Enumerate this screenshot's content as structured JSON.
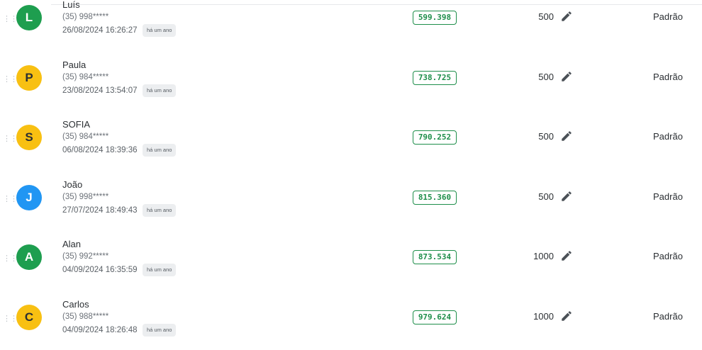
{
  "colors": {
    "green": "#1e9e4f",
    "yellow": "#f8c012",
    "blue": "#2196f3",
    "code_green": "#1e8e4a"
  },
  "rows": [
    {
      "initial": "L",
      "avatar_color": "#1e9e4f",
      "name": "Luís",
      "phone": "(35) 998*****",
      "date": "26/08/2024 16:26:27",
      "ago": "há um ano",
      "code": "599.398",
      "amount": "500",
      "edit_icon": "pencil-icon",
      "plan": "Padrão"
    },
    {
      "initial": "P",
      "avatar_color": "#f8c012",
      "name": "Paula",
      "phone": "(35) 984*****",
      "date": "23/08/2024 13:54:07",
      "ago": "há um ano",
      "code": "738.725",
      "amount": "500",
      "edit_icon": "pencil-icon",
      "plan": "Padrão"
    },
    {
      "initial": "S",
      "avatar_color": "#f8c012",
      "name": "SOFIA",
      "phone": "(35) 984*****",
      "date": "06/08/2024 18:39:36",
      "ago": "há um ano",
      "code": "790.252",
      "amount": "500",
      "edit_icon": "pencil-icon",
      "plan": "Padrão"
    },
    {
      "initial": "J",
      "avatar_color": "#2196f3",
      "name": "João",
      "phone": "(35) 998*****",
      "date": "27/07/2024 18:49:43",
      "ago": "há um ano",
      "code": "815.360",
      "amount": "500",
      "edit_icon": "pencil-icon",
      "plan": "Padrão"
    },
    {
      "initial": "A",
      "avatar_color": "#1e9e4f",
      "name": "Alan",
      "phone": "(35) 992*****",
      "date": "04/09/2024 16:35:59",
      "ago": "há um ano",
      "code": "873.534",
      "amount": "1000",
      "edit_icon": "pencil-icon",
      "plan": "Padrão"
    },
    {
      "initial": "C",
      "avatar_color": "#f8c012",
      "name": "Carlos",
      "phone": "(35) 988*****",
      "date": "04/09/2024 18:26:48",
      "ago": "há um ano",
      "code": "979.624",
      "amount": "1000",
      "edit_icon": "pencil-icon",
      "plan": "Padrão"
    }
  ]
}
